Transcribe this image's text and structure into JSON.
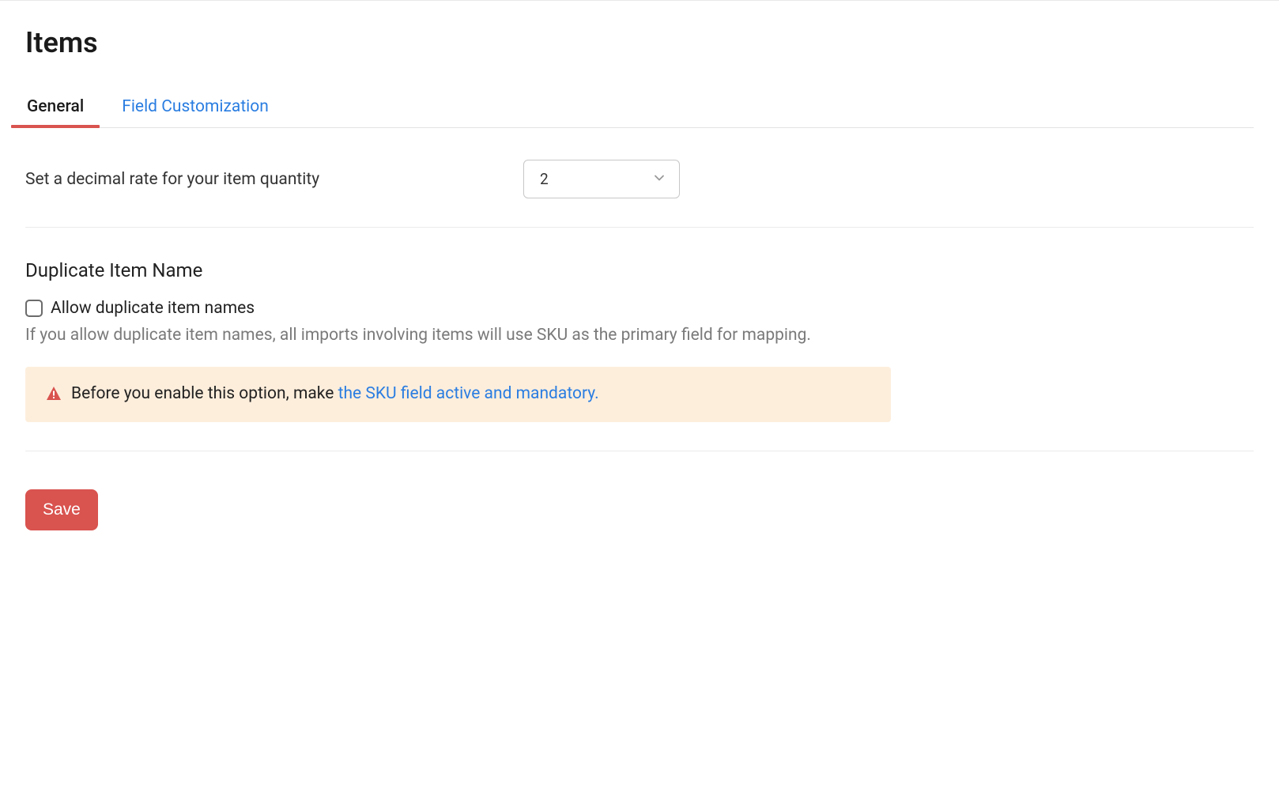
{
  "page": {
    "title": "Items"
  },
  "tabs": {
    "general": "General",
    "field_customization": "Field Customization"
  },
  "decimal": {
    "label": "Set a decimal rate for your item quantity",
    "value": "2"
  },
  "duplicate": {
    "title": "Duplicate Item Name",
    "checkbox_label": "Allow duplicate item names",
    "help_text": "If you allow duplicate item names, all imports involving items will use SKU as the primary field for mapping."
  },
  "alert": {
    "prefix": "Before you enable this option, make ",
    "link": "the SKU field active and mandatory."
  },
  "buttons": {
    "save": "Save"
  }
}
